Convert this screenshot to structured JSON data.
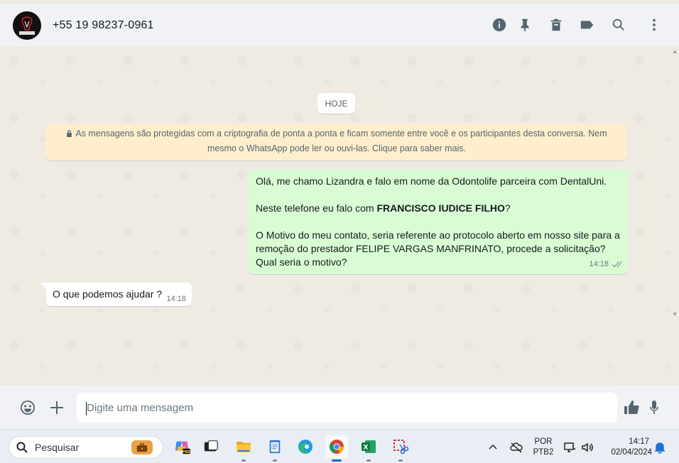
{
  "header": {
    "contact_name": "+55 19 98237-0961",
    "avatar_text": "IUDICE",
    "icons": [
      "info-icon",
      "pin-icon",
      "delete-icon",
      "label-icon",
      "search-icon",
      "menu-icon"
    ]
  },
  "chat": {
    "day_label": "HOJE",
    "encryption_notice": "As mensagens são protegidas com a criptografia de ponta a ponta e ficam somente entre você e os participantes desta conversa. Nem mesmo o WhatsApp pode ler ou ouvi-las. Clique para saber mais.",
    "outgoing": {
      "line1": "Olá, me chamo Lizandra e falo em nome da Odontolife parceira com DentalUni.",
      "line2_prefix": "Neste telefone eu falo com ",
      "line2_bold": "FRANCISCO IUDICE FILHO",
      "line2_suffix": "?",
      "line3": "O Motivo do meu contato, seria referente ao protocolo aberto em nosso site para a remoção do prestador  FELIPE VARGAS MANFRINATO, procede a solicitação? Qual seria o motivo?",
      "time": "14:18",
      "status": "delivered"
    },
    "incoming": {
      "text": "O que podemos ajudar ?",
      "time": "14:18"
    }
  },
  "composer": {
    "placeholder": "Digite uma mensagem"
  },
  "taskbar": {
    "search_label": "Pesquisar",
    "apps": [
      "copilot",
      "terminal",
      "file-explorer",
      "notepad",
      "edge",
      "chrome",
      "excel",
      "snipping-tool"
    ],
    "language_line1": "POR",
    "language_line2": "PTB2",
    "time": "14:17",
    "date": "02/04/2024"
  },
  "colors": {
    "outgoing_bubble": "#d9fdd3",
    "notice_bg": "#ffeecd",
    "chat_bg": "#efeae2",
    "header_bg": "#f0f2f5"
  }
}
